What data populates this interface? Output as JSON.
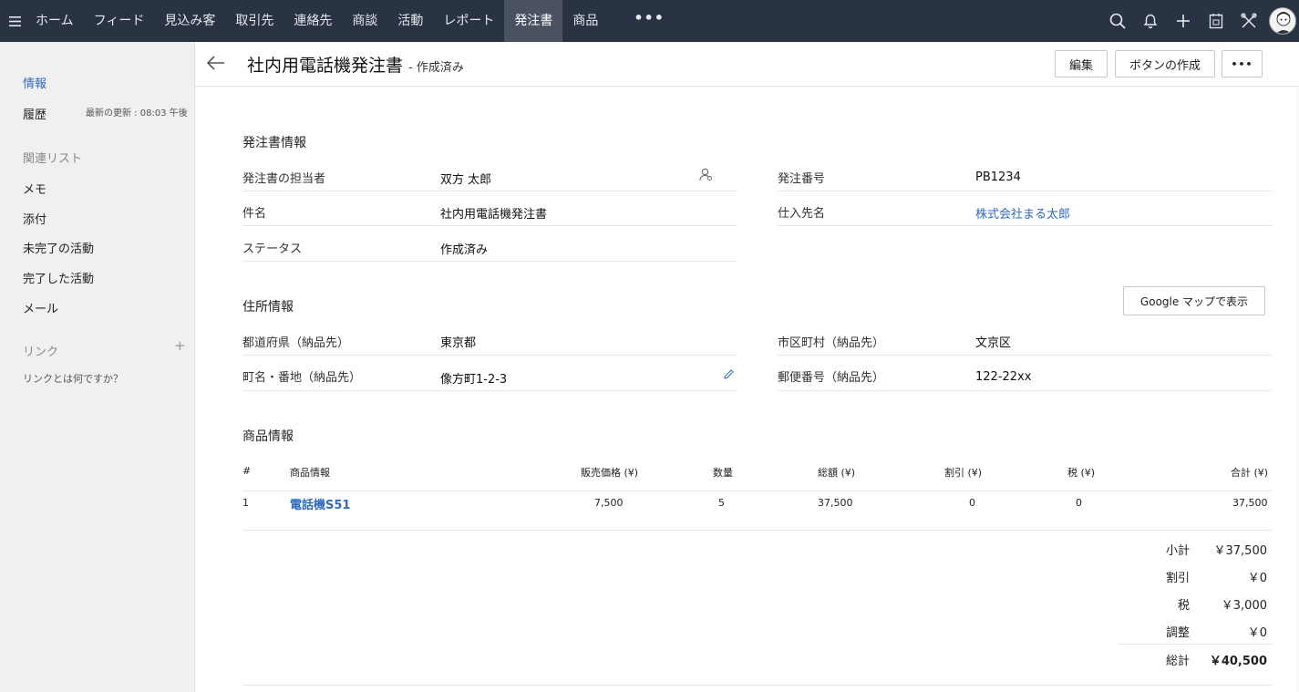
{
  "nav": {
    "menu_icon": "hamburger-icon",
    "items": [
      {
        "label": "ホーム"
      },
      {
        "label": "フィード"
      },
      {
        "label": "見込み客"
      },
      {
        "label": "取引先"
      },
      {
        "label": "連絡先"
      },
      {
        "label": "商談"
      },
      {
        "label": "活動"
      },
      {
        "label": "レポート"
      },
      {
        "label": "発注書",
        "active": true
      },
      {
        "label": "商品"
      }
    ],
    "more_label": "•••",
    "icons": [
      "search-icon",
      "bell-icon",
      "plus-icon",
      "calendar-icon",
      "tools-icon",
      "avatar"
    ]
  },
  "sidebar": {
    "info_label": "情報",
    "history_label": "履歴",
    "last_updated": "最新の更新 : 08:03 午後",
    "related_heading": "関連リスト",
    "related_items": [
      "メモ",
      "添付",
      "未完了の活動",
      "完了した活動",
      "メール"
    ],
    "links_heading": "リンク",
    "links_help": "リンクとは何ですか？"
  },
  "header": {
    "title": "社内用電話機発注書",
    "status": "- 作成済み",
    "edit_button": "編集",
    "create_button": "ボタンの作成",
    "more_button": "•••"
  },
  "po_info": {
    "section_title": "発注書情報",
    "owner_label": "発注書の担当者",
    "owner_value": "双方 太郎",
    "subject_label": "件名",
    "subject_value": "社内用電話機発注書",
    "status_label": "ステータス",
    "status_value": "作成済み",
    "po_number_label": "発注番号",
    "po_number_value": "PB1234",
    "vendor_label": "仕入先名",
    "vendor_value": "株式会社まる太郎"
  },
  "address": {
    "section_title": "住所情報",
    "map_button": "Google マップで表示",
    "prefecture_label": "都道府県（納品先）",
    "prefecture_value": "東京都",
    "city_label": "市区町村（納品先）",
    "city_value": "文京区",
    "street_label": "町名・番地（納品先）",
    "street_value": "像方町1-2-3",
    "zip_label": "郵便番号（納品先）",
    "zip_value": "122-22xx"
  },
  "products": {
    "section_title": "商品情報",
    "columns": [
      "#",
      "商品情報",
      "販売価格 (¥)",
      "数量",
      "総額 (¥)",
      "割引 (¥)",
      "税 (¥)",
      "合計 (¥)"
    ],
    "rows": [
      {
        "no": "1",
        "name": "電話機S51",
        "price": "7,500",
        "qty": "5",
        "amount": "37,500",
        "discount": "0",
        "tax": "0",
        "total": "37,500"
      }
    ],
    "summary": {
      "subtotal_label": "小計",
      "subtotal_value": "￥37,500",
      "discount_label": "割引",
      "discount_value": "￥0",
      "tax_label": "税",
      "tax_value": "￥3,000",
      "adjust_label": "調整",
      "adjust_value": "￥0",
      "grand_label": "総計",
      "grand_value": "￥40,500"
    }
  },
  "colors": {
    "topbar": "#2a3344",
    "active_tab": "#4a5262",
    "link": "#2d6bc4",
    "sidebar": "#f0f0f0"
  }
}
